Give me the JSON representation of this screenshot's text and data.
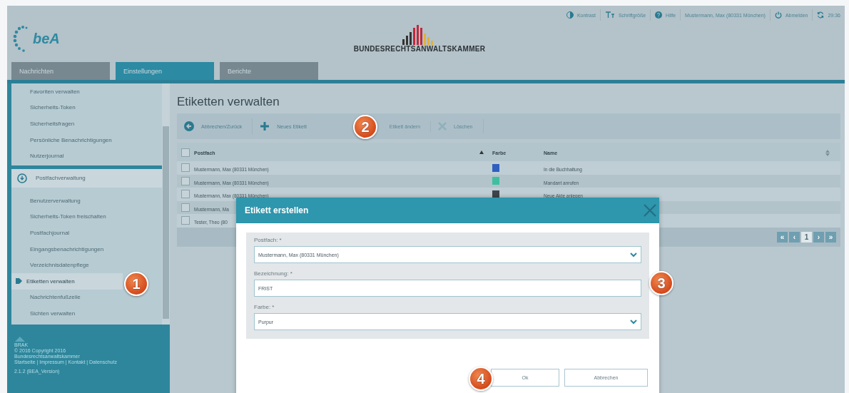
{
  "topbar": [
    {
      "kind": "contrast",
      "label": "Kontrast"
    },
    {
      "kind": "fontsize",
      "label": "Schriftgröße"
    },
    {
      "kind": "help",
      "label": "Hilfe"
    },
    {
      "kind": "user",
      "label": "Mustermann, Max (80331 München)"
    },
    {
      "kind": "logout",
      "label": "Abmelden"
    },
    {
      "kind": "timer",
      "label": "29:36"
    }
  ],
  "logo": {
    "text": "beA"
  },
  "brand": {
    "name": "BUNDESRECHTSANWALTSKAMMER"
  },
  "tabs": [
    {
      "label": "Nachrichten",
      "selected": false
    },
    {
      "label": "Einstellungen",
      "selected": true
    },
    {
      "label": "Berichte",
      "selected": false
    }
  ],
  "sidebar": {
    "groups": [
      {
        "items": [
          {
            "label": "Favoriten verwalten",
            "selected": false
          },
          {
            "label": "Sicherheits-Token",
            "selected": false
          },
          {
            "label": "Sicherheitsfragen",
            "selected": false
          },
          {
            "label": "Persönliche Benachrichtigungen",
            "selected": false
          },
          {
            "label": "Nutzerjournal",
            "selected": false
          }
        ]
      },
      {
        "header": "Postfachverwaltung",
        "items": [
          {
            "label": "Benutzerverwaltung",
            "selected": false
          },
          {
            "label": "Sicherheits-Token freischalten",
            "selected": false
          },
          {
            "label": "Postfachjournal",
            "selected": false
          },
          {
            "label": "Eingangsbenachrichtigungen",
            "selected": false
          },
          {
            "label": "Verzeichnisdatenpflege",
            "selected": false
          },
          {
            "label": "Etiketten verwalten",
            "selected": true
          },
          {
            "label": "Nachrichtenfußzeile",
            "selected": false
          },
          {
            "label": "Sichten verwalten",
            "selected": false
          }
        ]
      }
    ],
    "footer": {
      "logo_text": "BRAK",
      "lines": [
        "© 2016 Copyright 2016",
        "Bundesrechtsanwaltskammer",
        "Startseite | Impressum | Kontakt | Datenschutz",
        "2.1.2 (BEA_Version)"
      ]
    }
  },
  "page": {
    "title": "Etiketten verwalten",
    "toolbar": [
      {
        "kind": "back",
        "label": "Abbrechen/Zurück",
        "disabled": false
      },
      {
        "kind": "add",
        "label": "Neues Etikett",
        "disabled": false
      },
      {
        "kind": "edit",
        "label": "Etikett ändern",
        "disabled": true
      },
      {
        "kind": "delete",
        "label": "Löschen",
        "disabled": true
      }
    ],
    "table": {
      "columns": [
        "Postfach",
        "Farbe",
        "Name"
      ],
      "select_all": {
        "checked": false
      },
      "rows": [
        {
          "postfach": "Mustermann, Max (80331 München)",
          "color": "#2f5fbf",
          "name": "In die Buchhaltung",
          "checked": false
        },
        {
          "postfach": "Mustermann, Max (80331 München)",
          "color": "#3fbf9f",
          "name": "Mandant anrufen",
          "checked": false
        },
        {
          "postfach": "Mustermann, Max (80331 München)",
          "color": "#3d454b",
          "name": "Neue Akte anlegen",
          "checked": false
        },
        {
          "postfach": "Mustermann, Ma",
          "checked": false
        },
        {
          "postfach": "Tester, Theo (80",
          "checked": false
        }
      ]
    },
    "pagination": [
      {
        "label": "«",
        "selected": false
      },
      {
        "label": "‹",
        "selected": false
      },
      {
        "label": "1",
        "selected": true
      },
      {
        "label": "›",
        "selected": false
      },
      {
        "label": "»",
        "selected": false
      }
    ]
  },
  "dialog": {
    "title": "Etikett erstellen",
    "fields": [
      {
        "kind": "select",
        "label": "Postfach: *",
        "value": "Mustermann, Max (80331 München)"
      },
      {
        "kind": "text",
        "label": "Bezeichnung: *",
        "value": "FRIST"
      },
      {
        "kind": "select",
        "label": "Farbe: *",
        "value": "Purpur"
      }
    ],
    "buttons": [
      "Ok",
      "Abbrechen"
    ]
  },
  "callouts": [
    "1",
    "2",
    "3",
    "4"
  ]
}
